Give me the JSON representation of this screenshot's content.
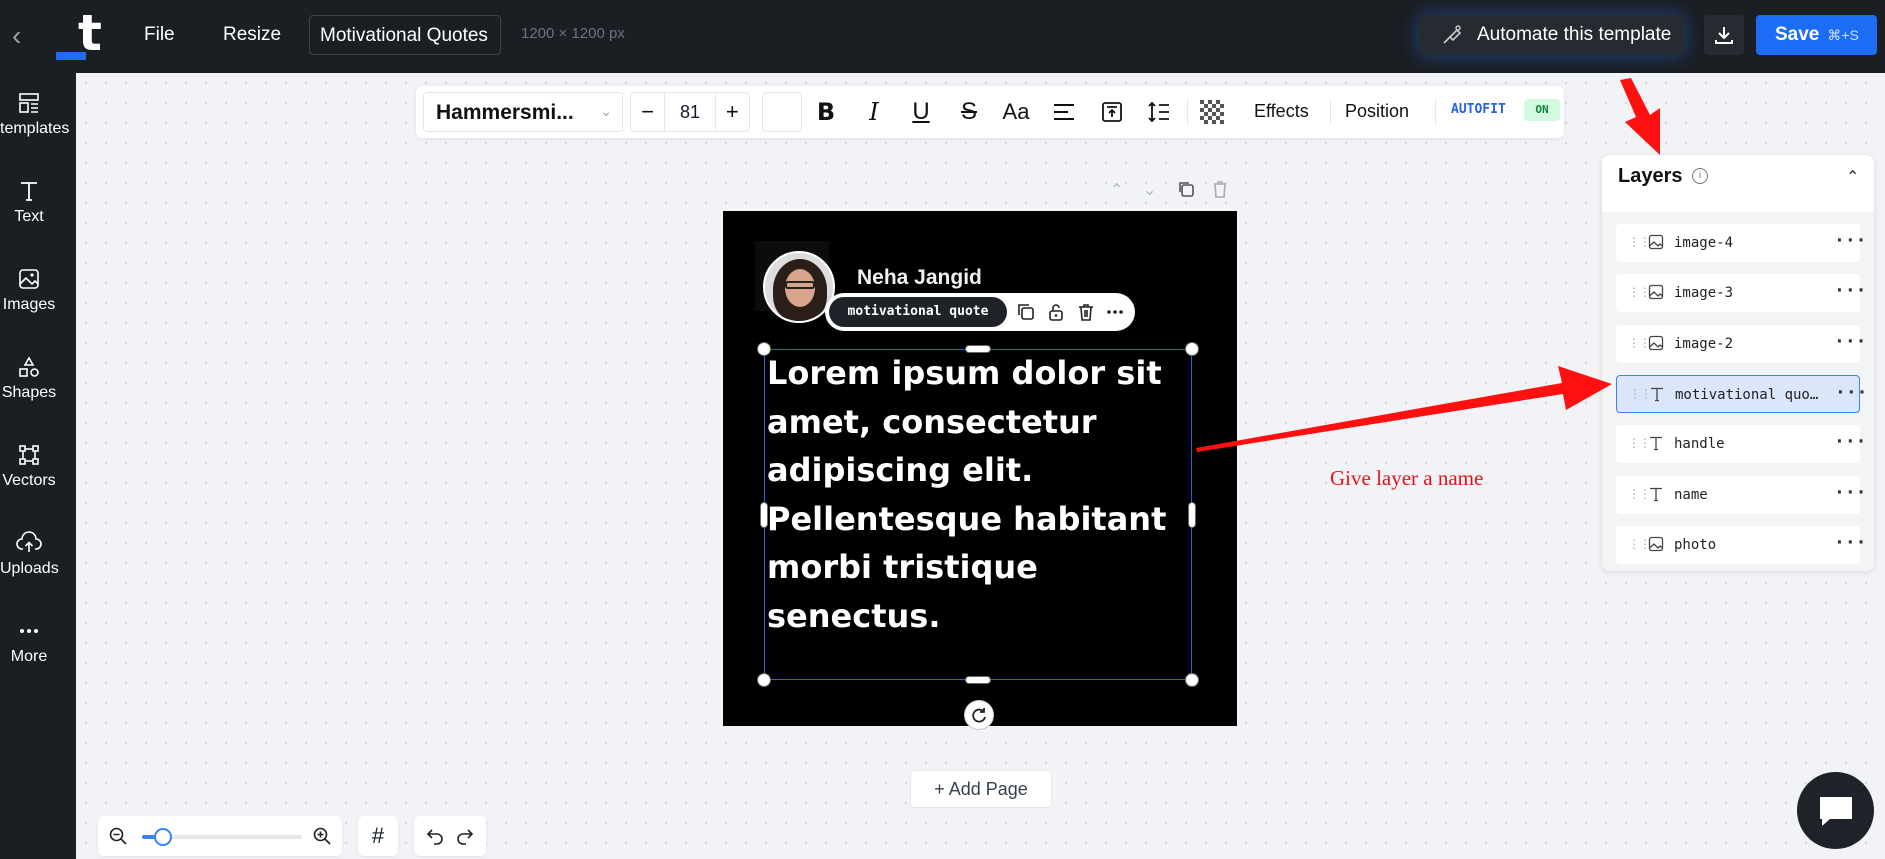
{
  "topbar": {
    "file_label": "File",
    "resize_label": "Resize",
    "document_title": "Motivational  Quotes",
    "dimensions": "1200 × 1200 px",
    "automate_label": "Automate this template",
    "save_label": "Save",
    "save_shortcut": "⌘+S"
  },
  "sidebar": {
    "items": [
      {
        "label": "templates",
        "icon": "templates-icon"
      },
      {
        "label": "Text",
        "icon": "text-icon"
      },
      {
        "label": "Images",
        "icon": "image-icon"
      },
      {
        "label": "Shapes",
        "icon": "shapes-icon"
      },
      {
        "label": "Vectors",
        "icon": "vectors-icon"
      },
      {
        "label": "Uploads",
        "icon": "upload-icon"
      },
      {
        "label": "More",
        "icon": "more-icon"
      }
    ]
  },
  "toolbar": {
    "font_name": "Hammersmi...",
    "font_size": "81",
    "minus": "−",
    "plus": "+",
    "bold": "B",
    "italic": "I",
    "underline": "U",
    "strike": "S",
    "case": "Aa",
    "effects_label": "Effects",
    "position_label": "Position",
    "autofit_label": "AUTOFIT",
    "autofit_state": "ON"
  },
  "design": {
    "name": "Neha Jangid",
    "quote": "Lorem ipsum dolor sit\namet, consectetur\nadipiscing elit.\nPellentesque habitant\nmorbi tristique senectus.",
    "selected_layer_label": "motivational quote"
  },
  "add_page_label": "+ Add Page",
  "layers": {
    "title": "Layers",
    "items": [
      {
        "name": "image-4",
        "type": "image"
      },
      {
        "name": "image-3",
        "type": "image"
      },
      {
        "name": "image-2",
        "type": "image"
      },
      {
        "name": "motivational quo…",
        "type": "text",
        "selected": true
      },
      {
        "name": "handle",
        "type": "text"
      },
      {
        "name": "name",
        "type": "text"
      },
      {
        "name": "photo",
        "type": "image"
      }
    ]
  },
  "annotation": "Give layer a name",
  "colors": {
    "accent": "#1d6cf5",
    "annotation": "#e5141b",
    "dark_bg": "#1b1f24"
  }
}
